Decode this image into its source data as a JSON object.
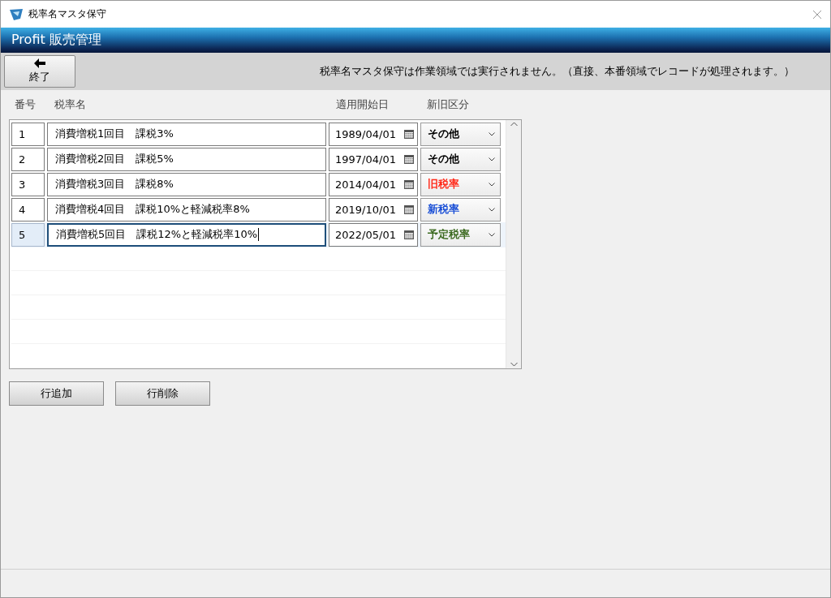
{
  "window": {
    "title": "税率名マスタ保守"
  },
  "header": {
    "title": "Profit 販売管理"
  },
  "toolbar": {
    "exit_button": "終了",
    "message": "税率名マスタ保守は作業領域では実行されません。（直接、本番領域でレコードが処理されます。）"
  },
  "table": {
    "columns": [
      "番号",
      "税率名",
      "適用開始日",
      "新旧区分"
    ],
    "rows": [
      {
        "number": "1",
        "name": "消費増税1回目　課税3%",
        "start_date": "1989/04/01",
        "category": "その他",
        "color": "#000000",
        "selected": false
      },
      {
        "number": "2",
        "name": "消費増税2回目　課税5%",
        "start_date": "1997/04/01",
        "category": "その他",
        "color": "#000000",
        "selected": false
      },
      {
        "number": "3",
        "name": "消費増税3回目　課税8%",
        "start_date": "2014/04/01",
        "category": "旧税率",
        "color": "#ff2a1a",
        "selected": false
      },
      {
        "number": "4",
        "name": "消費増税4回目　課税10%と軽減税率8%",
        "start_date": "2019/10/01",
        "category": "新税率",
        "color": "#1a4fd6",
        "selected": false
      },
      {
        "number": "5",
        "name": "消費増税5回目　課税12%と軽減税率10%",
        "start_date": "2022/05/01",
        "category": "予定税率",
        "color": "#3d6b22",
        "selected": true
      }
    ]
  },
  "buttons": [
    "行追加",
    "行削除"
  ]
}
